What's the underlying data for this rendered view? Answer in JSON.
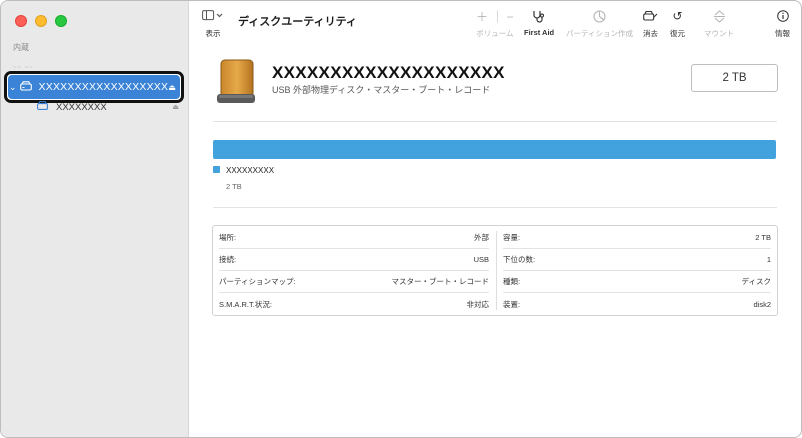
{
  "sidebar": {
    "section_label": "内蔵",
    "faint_label": "~~ ~~",
    "selected_disk": "XXXXXXXXXXXXXXXXXX",
    "sub_volume": "XXXXXXXX"
  },
  "toolbar": {
    "view_label": "表示",
    "app_title": "ディスクユーティリティ",
    "volume_label": "ボリューム",
    "firstaid_label": "First Aid",
    "partition_label": "パーティション作成",
    "erase_label": "消去",
    "restore_label": "復元",
    "mount_label": "マウント",
    "info_label": "情報"
  },
  "drive": {
    "name": "XXXXXXXXXXXXXXXXXXXX",
    "subtitle": "USB 外部物理ディスク・マスター・ブート・レコード",
    "capacity": "2 TB"
  },
  "usage": {
    "volume_name": "XXXXXXXXX",
    "volume_size": "2 TB",
    "fill_fraction": 1.0
  },
  "info": {
    "left": [
      {
        "label": "場所:",
        "value": "外部"
      },
      {
        "label": "接続:",
        "value": "USB"
      },
      {
        "label": "パーティションマップ:",
        "value": "マスター・ブート・レコード"
      },
      {
        "label": "S.M.A.R.T.状況:",
        "value": "非対応"
      }
    ],
    "right": [
      {
        "label": "容量:",
        "value": "2 TB"
      },
      {
        "label": "下位の数:",
        "value": "1"
      },
      {
        "label": "種類:",
        "value": "ディスク"
      },
      {
        "label": "装置:",
        "value": "disk2"
      }
    ]
  },
  "colors": {
    "accent": "#3b83d6",
    "usage_bar": "#42a2dd"
  }
}
